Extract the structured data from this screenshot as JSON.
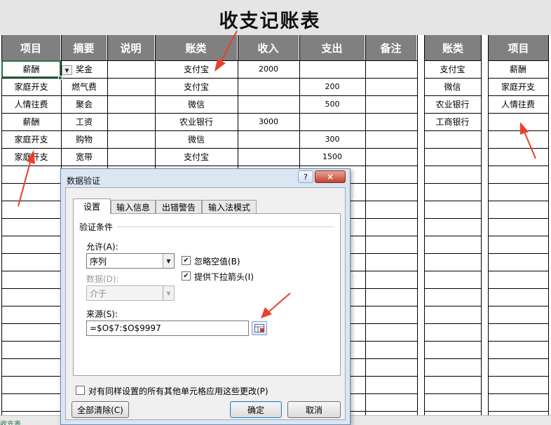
{
  "title": "收支记账表",
  "main_table": {
    "headers": [
      "项目",
      "摘要",
      "说明",
      "账类",
      "收入",
      "支出",
      "备注"
    ],
    "rows": [
      {
        "项目": "薪酬",
        "摘要": "奖金",
        "账类": "支付宝",
        "收入": "2000",
        "支出": ""
      },
      {
        "项目": "家庭开支",
        "摘要": "燃气费",
        "账类": "支付宝",
        "收入": "",
        "支出": "200"
      },
      {
        "项目": "人情往费",
        "摘要": "聚会",
        "账类": "微信",
        "收入": "",
        "支出": "500"
      },
      {
        "项目": "薪酬",
        "摘要": "工资",
        "账类": "农业银行",
        "收入": "3000",
        "支出": ""
      },
      {
        "项目": "家庭开支",
        "摘要": "购物",
        "账类": "微信",
        "收入": "",
        "支出": "300"
      },
      {
        "项目": "家庭开支",
        "摘要": "宽带",
        "账类": "支付宝",
        "收入": "",
        "支出": "1500"
      }
    ]
  },
  "ref_account": {
    "header": "账类",
    "items": [
      "支付宝",
      "微信",
      "农业银行",
      "工商银行"
    ]
  },
  "ref_item": {
    "header": "项目",
    "items": [
      "薪酬",
      "家庭开支",
      "人情往费"
    ]
  },
  "sheet_tab": "收支表",
  "dialog": {
    "title": "数据验证",
    "help_label": "?",
    "close_label": "×",
    "tabs": [
      "设置",
      "输入信息",
      "出错警告",
      "输入法模式"
    ],
    "active_tab": "设置",
    "section_label": "验证条件",
    "allow_label": "允许(A):",
    "allow_value": "序列",
    "data_label": "数据(D):",
    "data_value": "介于",
    "ignore_blank_label": "忽略空值(B)",
    "ignore_blank_checked": true,
    "dropdown_label": "提供下拉箭头(I)",
    "dropdown_checked": true,
    "source_label": "来源(S):",
    "source_value": "=$O$7:$O$9997",
    "apply_all_label": "对有同样设置的所有其他单元格应用这些更改(P)",
    "apply_all_checked": false,
    "clear_all_label": "全部清除(C)",
    "ok_label": "确定",
    "cancel_label": "取消"
  },
  "colors": {
    "header_bg": "#808080",
    "title_bg": "#e5e5e5",
    "arrow_red": "#e8402a",
    "selection_green": "#217346",
    "dialog_frame": "#dbe6f3"
  }
}
